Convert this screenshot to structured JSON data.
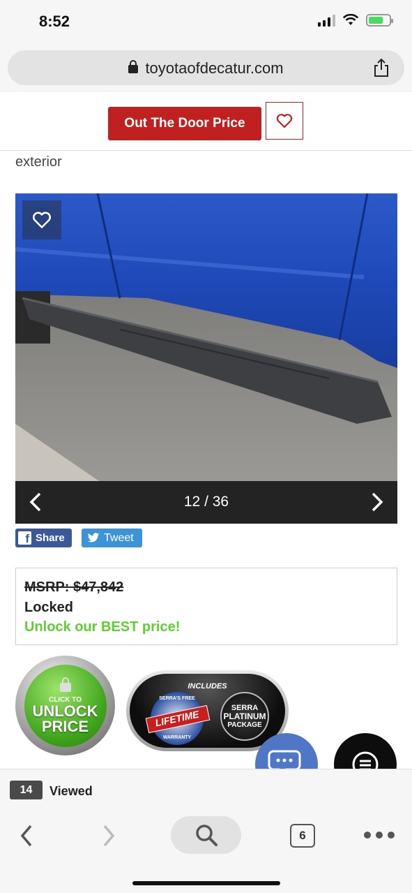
{
  "status_bar": {
    "time": "8:52",
    "battery_level": 0.7
  },
  "browser": {
    "url": "toyotaofdecatur.com",
    "viewed_count": "14",
    "viewed_label": "Viewed",
    "tab_count": "6"
  },
  "header": {
    "out_the_door_label": "Out The Door Price"
  },
  "section": {
    "label": "exterior"
  },
  "gallery": {
    "counter": "12 / 36"
  },
  "social": {
    "share_label": "Share",
    "tweet_label": "Tweet"
  },
  "pricing": {
    "msrp": "MSRP: $47,842",
    "locked": "Locked",
    "unlock_text": "Unlock our BEST price!"
  },
  "badges": {
    "click_to": "CLICK TO",
    "unlock": "UNLOCK",
    "price": "PRICE",
    "includes": "INCLUDES",
    "warranty_top": "SERRA'S FREE",
    "warranty_main": "LIFETIME",
    "warranty_bottom": "WARRANTY",
    "platinum_brand": "SERRA",
    "platinum_main": "PLATINUM",
    "platinum_sub": "PACKAGE"
  },
  "colors": {
    "brand_red": "#c0201f",
    "unlock_green": "#5fcf2f",
    "facebook": "#3b5998",
    "twitter": "#3b93d8",
    "chat_blue": "#5077c6"
  }
}
